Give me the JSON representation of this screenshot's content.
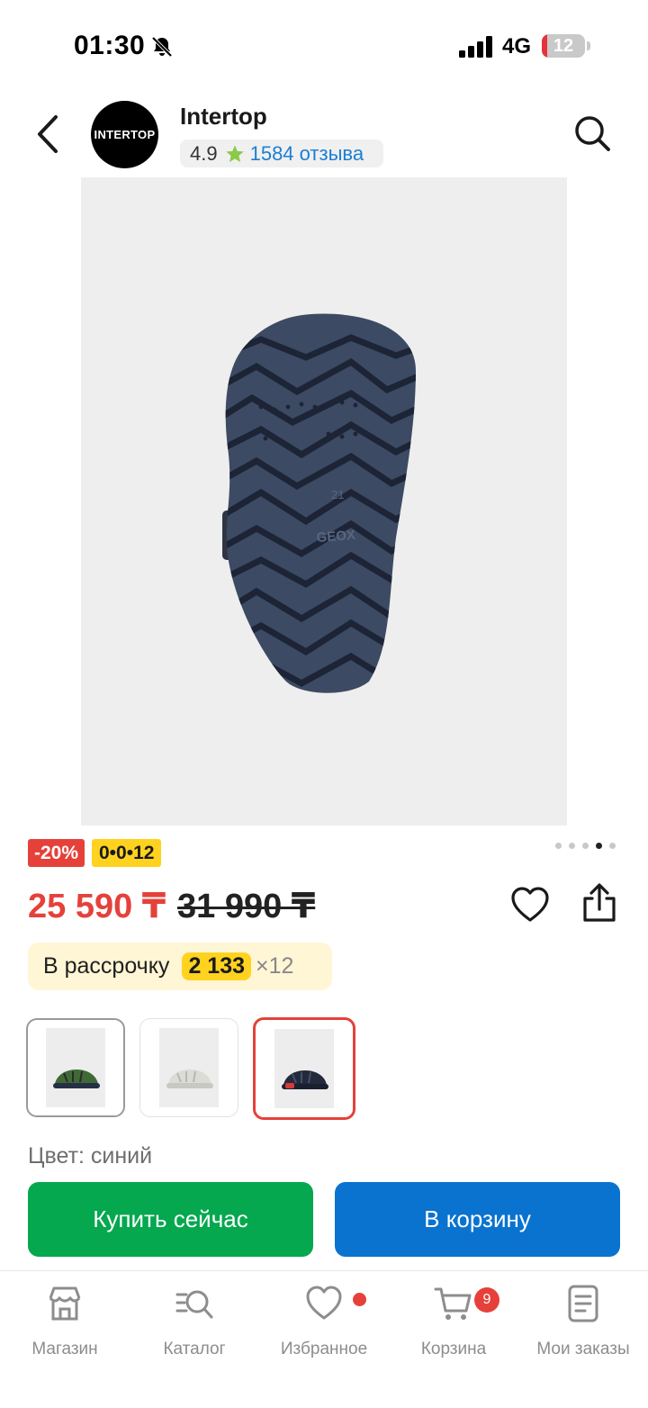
{
  "status_bar": {
    "time": "01:30",
    "network": "4G",
    "battery": "12",
    "battery_level_percent": 12,
    "icons": [
      "bell-off-icon",
      "signal-icon",
      "battery-icon"
    ]
  },
  "header": {
    "logo_text": "INTERTOP",
    "shop_name": "Intertop",
    "rating": "4.9",
    "reviews": "1584 отзыва",
    "icons": [
      "back-arrow-icon",
      "star-icon",
      "search-icon"
    ],
    "star_color": "#8cc84b"
  },
  "gallery": {
    "current_index": 4,
    "total": 5,
    "sole_marks": [
      "21",
      "GEOX"
    ]
  },
  "badges": {
    "discount": "-20%",
    "installment": "0•0•12"
  },
  "price": {
    "current": "25 590 ₸",
    "old": "31 990 ₸",
    "current_color": "#e5413a"
  },
  "installment": {
    "label": "В рассрочку",
    "amount": "2 133",
    "times": "×12"
  },
  "colors": {
    "label": "Цвет: синий",
    "options": [
      "green",
      "white",
      "blue"
    ],
    "selected_index": 2
  },
  "actions": {
    "buy_now": "Купить сейчас",
    "add_to_cart": "В корзину",
    "buy_color": "#05a84f",
    "cart_color": "#0a73d0"
  },
  "bottom_nav": {
    "items": [
      {
        "label": "Магазин",
        "icon": "store-icon"
      },
      {
        "label": "Каталог",
        "icon": "catalog-search-icon"
      },
      {
        "label": "Избранное",
        "icon": "heart-icon"
      },
      {
        "label": "Корзина",
        "icon": "cart-icon"
      },
      {
        "label": "Мои заказы",
        "icon": "orders-icon"
      }
    ],
    "cart_count": "9"
  }
}
